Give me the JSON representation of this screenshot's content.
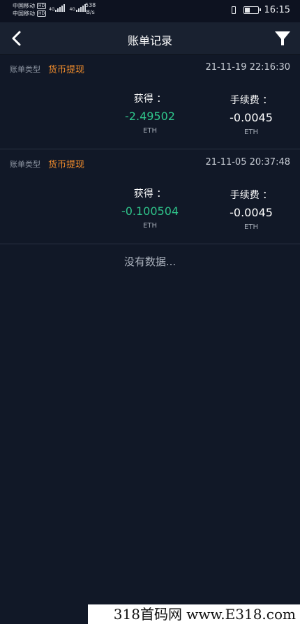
{
  "status_bar": {
    "carrier_1": "中国移动",
    "carrier_2": "中国移动",
    "hd_badge": "HD",
    "net_1": "4G",
    "net_2": "4G",
    "speed_value": "538",
    "speed_unit": "B/s",
    "battery_level": 0.4,
    "time": "16:15"
  },
  "navbar": {
    "back_icon": "chevron-left-icon",
    "title": "账单记录",
    "filter_icon": "filter-icon"
  },
  "records": [
    {
      "type_label": "账单类型",
      "type": "货币提现",
      "time": "21-11-19 22:16:30",
      "gain_label": "获得 ：",
      "gain_value": "-2.49502",
      "gain_unit": "ETH",
      "fee_label": "手续费 ：",
      "fee_value": "-0.0045",
      "fee_unit": "ETH"
    },
    {
      "type_label": "账单类型",
      "type": "货币提现",
      "time": "21-11-05 20:37:48",
      "gain_label": "获得 ：",
      "gain_value": "-0.100504",
      "gain_unit": "ETH",
      "fee_label": "手续费 ：",
      "fee_value": "-0.0045",
      "fee_unit": "ETH"
    }
  ],
  "no_data": "没有数据...",
  "watermark": "318首码网 www.E318.com",
  "colors": {
    "background": "#111827",
    "navbar": "#192130",
    "accent_orange": "#f08c2c",
    "gain_green": "#2fc58b"
  }
}
